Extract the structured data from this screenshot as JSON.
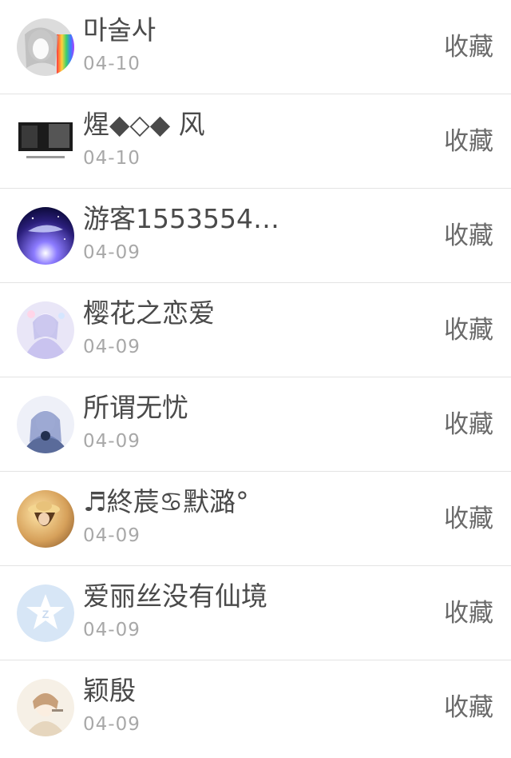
{
  "action_label": "收藏",
  "users": [
    {
      "name": "마술사",
      "date": "04-10",
      "avatar": "anime-girl-rainbow-avatar"
    },
    {
      "name": "煋◆◇◆ 风",
      "date": "04-10",
      "avatar": "dark-piano-avatar"
    },
    {
      "name": "游客1553554…",
      "date": "04-09",
      "avatar": "night-sky-whale-avatar"
    },
    {
      "name": "樱花之恋爱",
      "date": "04-09",
      "avatar": "anime-girl-white-dress-avatar"
    },
    {
      "name": "所谓无忧",
      "date": "04-09",
      "avatar": "anime-girl-blue-hair-avatar"
    },
    {
      "name": "♬終莀♋默潞°",
      "date": "04-09",
      "avatar": "girl-straw-hat-avatar"
    },
    {
      "name": "爱丽丝没有仙境",
      "date": "04-09",
      "avatar": "default-qzone-star-avatar"
    },
    {
      "name": "颖殷",
      "date": "04-09",
      "avatar": "anime-boy-avatar"
    }
  ]
}
